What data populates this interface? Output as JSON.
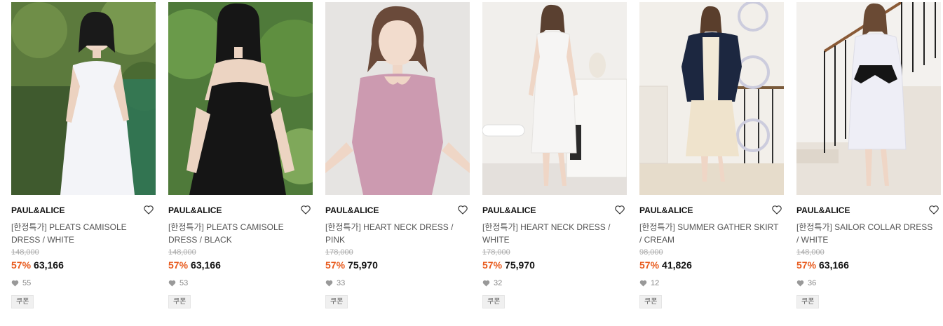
{
  "products": [
    {
      "brand": "PAUL&ALICE",
      "name": "[한정특가] PLEATS CAMISOLE DRESS / WHITE",
      "original_price": "148,000",
      "discount": "57%",
      "price": "63,166",
      "likes": "55",
      "coupon": "쿠폰",
      "image_icon": "product-photo-white-camisole-dress"
    },
    {
      "brand": "PAUL&ALICE",
      "name": "[한정특가] PLEATS CAMISOLE DRESS / BLACK",
      "original_price": "148,000",
      "discount": "57%",
      "price": "63,166",
      "likes": "53",
      "coupon": "쿠폰",
      "image_icon": "product-photo-black-camisole-dress"
    },
    {
      "brand": "PAUL&ALICE",
      "name": "[한정특가] HEART NECK DRESS / PINK",
      "original_price": "178,000",
      "discount": "57%",
      "price": "75,970",
      "likes": "33",
      "coupon": "쿠폰",
      "image_icon": "product-photo-pink-heart-neck-dress"
    },
    {
      "brand": "PAUL&ALICE",
      "name": "[한정특가] HEART NECK DRESS / WHITE",
      "original_price": "178,000",
      "discount": "57%",
      "price": "75,970",
      "likes": "32",
      "coupon": "쿠폰",
      "image_icon": "product-photo-white-heart-neck-dress"
    },
    {
      "brand": "PAUL&ALICE",
      "name": "[한정특가] SUMMER GATHER SKIRT / CREAM",
      "original_price": "98,000",
      "discount": "57%",
      "price": "41,826",
      "likes": "12",
      "coupon": "쿠폰",
      "image_icon": "product-photo-cream-gather-skirt"
    },
    {
      "brand": "PAUL&ALICE",
      "name": "[한정특가] SAILOR COLLAR DRESS / WHITE",
      "original_price": "148,000",
      "discount": "57%",
      "price": "63,166",
      "likes": "36",
      "coupon": "쿠폰",
      "image_icon": "product-photo-white-sailor-dress"
    }
  ],
  "colors": {
    "discount": "#e85a1c",
    "brand": "#111111",
    "muted": "#888888"
  }
}
